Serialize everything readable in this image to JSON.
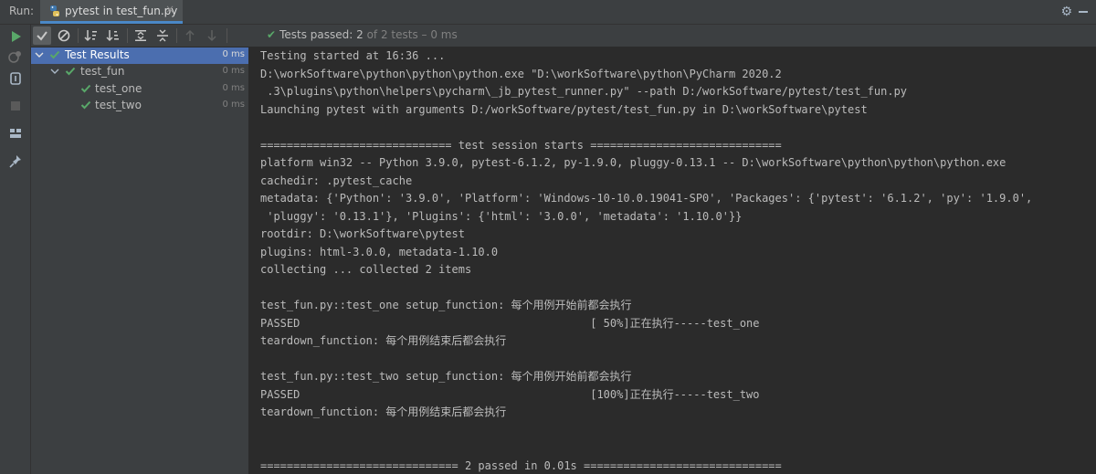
{
  "run_header": {
    "label": "Run:",
    "tab_title": "pytest in test_fun.py",
    "tab_icon": "python-icon",
    "close": "×",
    "gear": "⚙"
  },
  "status": {
    "text": "Tests passed:",
    "passed": "2",
    "rest": "of 2 tests – 0 ms"
  },
  "tree": [
    {
      "label": "Test Results",
      "time": "0 ms",
      "selected": true
    },
    {
      "label": "test_fun",
      "time": "0 ms",
      "selected": false
    },
    {
      "label": "test_one",
      "time": "0 ms",
      "selected": false
    },
    {
      "label": "test_two",
      "time": "0 ms",
      "selected": false
    }
  ],
  "console": {
    "lines": [
      "Testing started at 16:36 ...",
      "D:\\workSoftware\\python\\python\\python.exe \"D:\\workSoftware\\python\\PyCharm 2020.2",
      " .3\\plugins\\python\\helpers\\pycharm\\_jb_pytest_runner.py\" --path D:/workSoftware/pytest/test_fun.py",
      "Launching pytest with arguments D:/workSoftware/pytest/test_fun.py in D:\\workSoftware\\pytest",
      "",
      "============================= test session starts =============================",
      "platform win32 -- Python 3.9.0, pytest-6.1.2, py-1.9.0, pluggy-0.13.1 -- D:\\workSoftware\\python\\python\\python.exe",
      "cachedir: .pytest_cache",
      "metadata: {'Python': '3.9.0', 'Platform': 'Windows-10-10.0.19041-SP0', 'Packages': {'pytest': '6.1.2', 'py': '1.9.0',",
      " 'pluggy': '0.13.1'}, 'Plugins': {'html': '3.0.0', 'metadata': '1.10.0'}}",
      "rootdir: D:\\workSoftware\\pytest",
      "plugins: html-3.0.0, metadata-1.10.0",
      "collecting ... collected 2 items",
      "",
      "test_fun.py::test_one setup_function: 每个用例开始前都会执行",
      "PASSED                                            [ 50%]正在执行-----test_one",
      "teardown_function: 每个用例结束后都会执行",
      "",
      "test_fun.py::test_two setup_function: 每个用例开始前都会执行",
      "PASSED                                            [100%]正在执行-----test_two",
      "teardown_function: 每个用例结束后都会执行",
      "",
      "",
      "============================== 2 passed in 0.01s =============================="
    ]
  },
  "colors": {
    "pass_green": "#59a869",
    "selection_blue": "#4b6eaf",
    "tab_underline": "#4a88c7"
  }
}
